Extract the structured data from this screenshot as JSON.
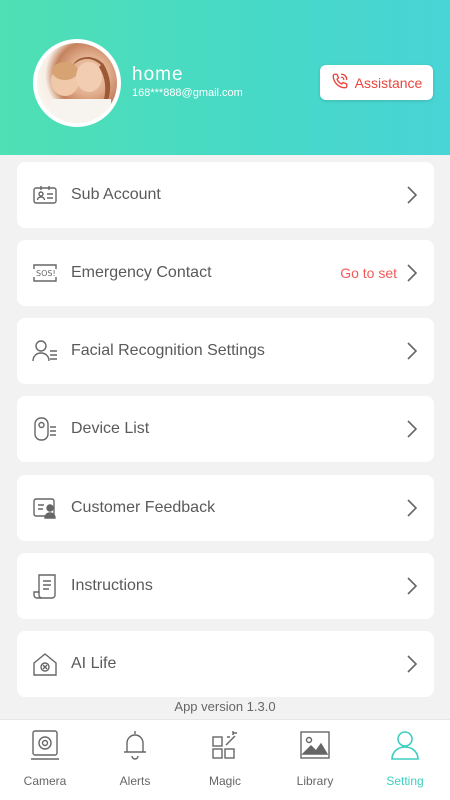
{
  "profile": {
    "name": "home",
    "email": "168***888@gmail.com",
    "assistance_label": "Assistance"
  },
  "menu": [
    {
      "label": "Sub Account",
      "icon": "id-card-icon",
      "extra": ""
    },
    {
      "label": "Emergency Contact",
      "icon": "sos-icon",
      "extra": "Go to set"
    },
    {
      "label": "Facial Recognition Settings",
      "icon": "face-user-icon",
      "extra": ""
    },
    {
      "label": "Device List",
      "icon": "camera-device-icon",
      "extra": ""
    },
    {
      "label": "Customer Feedback",
      "icon": "feedback-icon",
      "extra": ""
    },
    {
      "label": "Instructions",
      "icon": "document-icon",
      "extra": ""
    },
    {
      "label": "AI Life",
      "icon": "ai-home-icon",
      "extra": ""
    }
  ],
  "version": "App version 1.3.0",
  "tabs": [
    {
      "label": "Camera",
      "icon": "camera-icon",
      "active": false
    },
    {
      "label": "Alerts",
      "icon": "bell-icon",
      "active": false
    },
    {
      "label": "Magic",
      "icon": "magic-grid-icon",
      "active": false
    },
    {
      "label": "Library",
      "icon": "image-library-icon",
      "active": false
    },
    {
      "label": "Setting",
      "icon": "user-setting-icon",
      "active": true
    }
  ],
  "colors": {
    "header_start": "#4fe0b4",
    "header_end": "#49d4d6",
    "accent": "#3ccfc0",
    "alert_red": "#e8463d"
  }
}
